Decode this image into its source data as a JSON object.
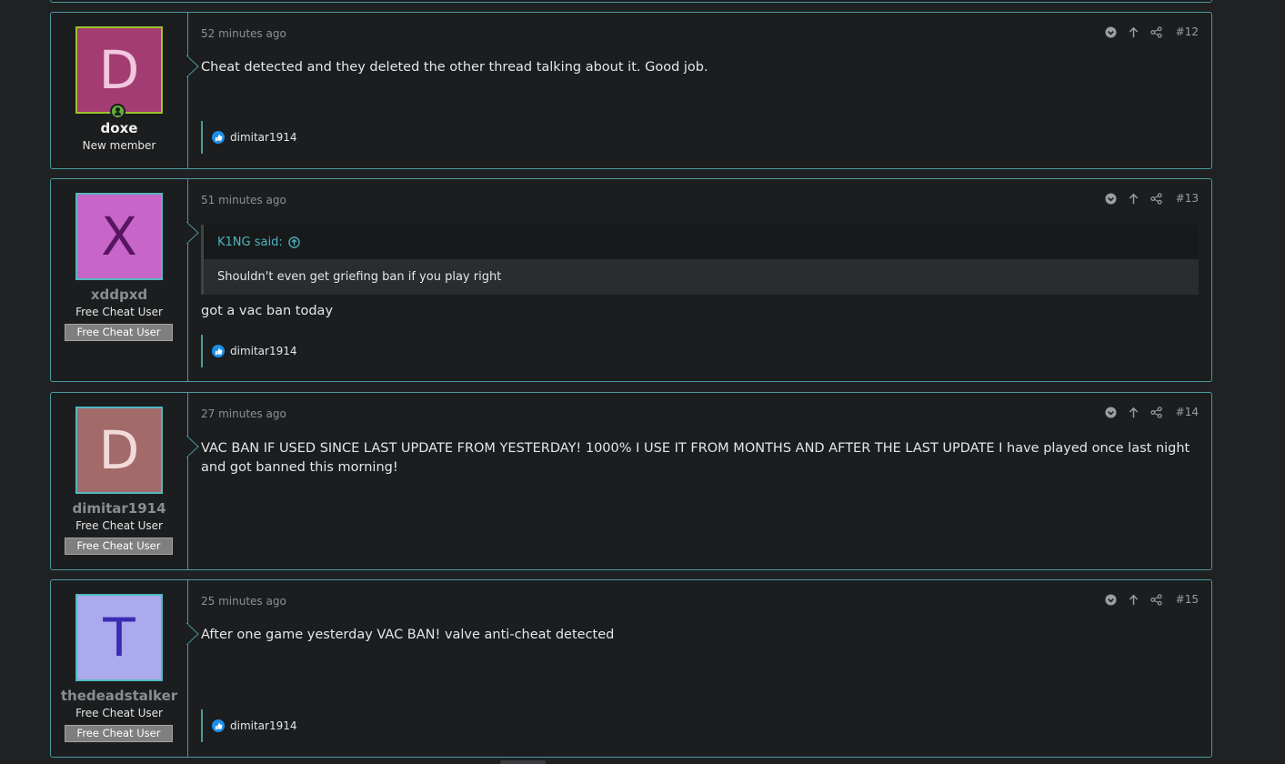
{
  "posts": [
    {
      "avatar_letter": "D",
      "avatar_bg": "#a23c72",
      "avatar_fg": "#f0c7de",
      "username": "doxe",
      "user_title": "New member",
      "date": "52 minutes ago",
      "post_number": "#12",
      "message": "Cheat detected and they deleted the other thread talking about it. Good job.",
      "reaction_user": "dimitar1914"
    },
    {
      "avatar_letter": "X",
      "avatar_bg": "#c865c8",
      "avatar_fg": "#5a1561",
      "username": "xddpxd",
      "user_title": "Free Cheat User",
      "user_banner": "Free Cheat User",
      "date": "51 minutes ago",
      "post_number": "#13",
      "quote_author": "K1NG said:",
      "quote_text": "Shouldn't even get griefing ban if you play right",
      "message": "got a vac ban today",
      "reaction_user": "dimitar1914"
    },
    {
      "avatar_letter": "D",
      "avatar_bg": "#a36a6a",
      "avatar_fg": "#f1dada",
      "username": "dimitar1914",
      "user_title": "Free Cheat User",
      "user_banner": "Free Cheat User",
      "date": "27 minutes ago",
      "post_number": "#14",
      "message": "VAC BAN IF USED SINCE LAST UPDATE FROM YESTERDAY! 1000% I USE IT FROM MONTHS AND AFTER THE LAST UPDATE I have played once last night and got banned this morning!"
    },
    {
      "avatar_letter": "T",
      "avatar_bg": "#abaaed",
      "avatar_fg": "#3a2bb3",
      "username": "thedeadstalker",
      "user_title": "Free Cheat User",
      "user_banner": "Free Cheat User",
      "date": "25 minutes ago",
      "post_number": "#15",
      "message": "After one game yesterday VAC BAN! valve anti-cheat detected",
      "reaction_user": "dimitar1914"
    }
  ],
  "icons": {
    "menu": "chevron-down-circle-icon",
    "up": "arrow-up-icon",
    "share": "share-icon",
    "like": "thumbs-up-icon",
    "quote_link": "arrow-up-circle-icon",
    "online": "online-user-icon"
  }
}
